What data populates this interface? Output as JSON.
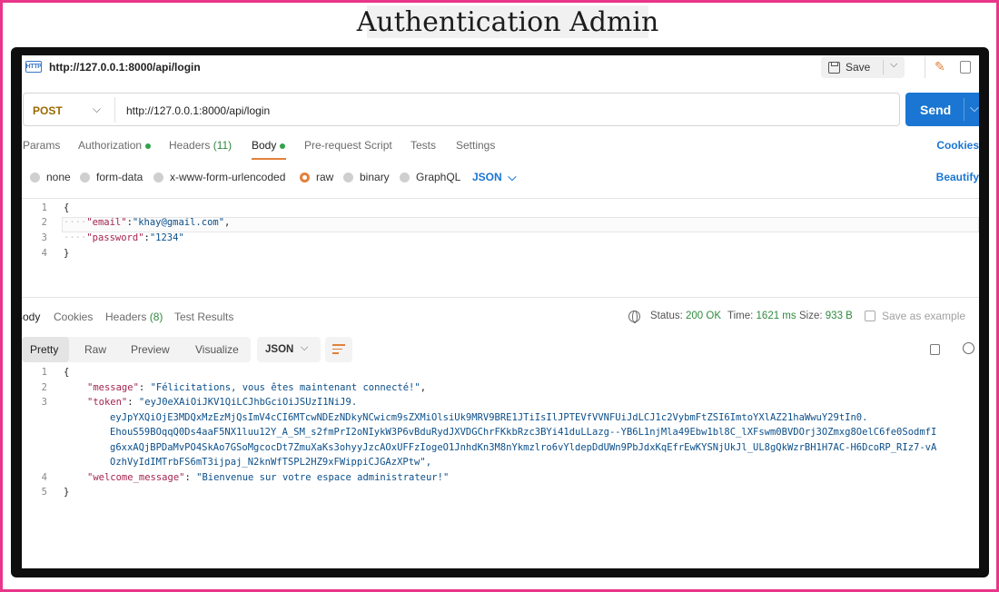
{
  "page_title": "Authentication Admin",
  "request": {
    "name": "http://127.0.0.1:8000/api/login",
    "save_label": "Save",
    "method": "POST",
    "url": "http://127.0.0.1:8000/api/login",
    "send_label": "Send",
    "tabs": {
      "params": "Params",
      "authorization": "Authorization",
      "headers": "Headers",
      "headers_count": "(11)",
      "body": "Body",
      "pre_request": "Pre-request Script",
      "tests": "Tests",
      "settings": "Settings"
    },
    "cookies_label": "Cookies",
    "body_types": {
      "none": "none",
      "form_data": "form-data",
      "urlencoded": "x-www-form-urlencoded",
      "raw": "raw",
      "binary": "binary",
      "graphql": "GraphQL"
    },
    "body_format": "JSON",
    "beautify_label": "Beautify",
    "body_code": {
      "open": "{",
      "email_key": "\"email\"",
      "email_value": "\"khay@gmail.com\"",
      "password_key": "\"password\"",
      "password_value": "\"1234\"",
      "close": "}"
    }
  },
  "response": {
    "tabs": {
      "body": "Body",
      "cookies": "Cookies",
      "headers": "Headers",
      "headers_count": "(8)",
      "test_results": "Test Results"
    },
    "status_label": "Status:",
    "status_value": "200 OK",
    "time_label": "Time:",
    "time_value": "1621 ms",
    "size_label": "Size:",
    "size_value": "933 B",
    "save_example_label": "Save as example",
    "views": {
      "pretty": "Pretty",
      "raw": "Raw",
      "preview": "Preview",
      "visualize": "Visualize"
    },
    "format": "JSON",
    "body_code": {
      "open": "{",
      "message_key": "\"message\"",
      "message_value": "\"Félicitations, vous êtes maintenant connecté!\"",
      "token_key": "\"token\"",
      "token_line1": "\"eyJ0eXAiOiJKV1QiLCJhbGciOiJSUzI1NiJ9.",
      "token_line2": "eyJpYXQiOjE3MDQxMzEzMjQsImV4cCI6MTcwNDEzNDkyNCwicm9sZXMiOlsiUk9MRV9BRE1JTiIsIlJPTEVfVVNFUiJdLCJ1c2VybmFtZSI6ImtoYXlAZ21haWwuY29tIn0.",
      "token_line3": "EhouS59BOqqQ0Ds4aaF5NX1luu12Y_A_SM_s2fmPrI2oNIykW3P6vBduRydJXVDGChrFKkbRzc3BYi41duLLazg--YB6L1njMla49Ebw1bl8C_lXFswm0BVDOrj3OZmxg8OelC6fe0SodmfI",
      "token_line4": "g6xxAQjBPDaMvPO4SkAo7GSoMgcocDt7ZmuXaKs3ohyyJzcAOxUFFzIogeO1JnhdKn3M8nYkmzlro6vYldepDdUWn9PbJdxKqEfrEwKYSNjUkJl_UL8gQkWzrBH1H7AC-H6DcoRP_RIz7-vA",
      "token_line5": "OzhVyIdIMTrbFS6mT3ijpaj_N2knWfTSPL2HZ9xFWippiCJGAzXPtw\"",
      "welcome_key": "\"welcome_message\"",
      "welcome_value": "\"Bienvenue sur votre espace administrateur!\"",
      "close": "}"
    }
  },
  "icons": {
    "http": "http-file-icon",
    "save": "floppy-disk-icon",
    "edit": "pencil-icon",
    "docs": "document-icon",
    "network": "globe-icon",
    "wrap": "wrap-lines-icon",
    "copy": "copy-icon",
    "search": "search-icon"
  },
  "colors": {
    "frame_border": "#e9358a",
    "send_button": "#1a76d2",
    "accent": "#e1813b",
    "status_ok": "#2f8a3e",
    "json_key": "#a4244e",
    "json_string": "#0b4f8a"
  }
}
